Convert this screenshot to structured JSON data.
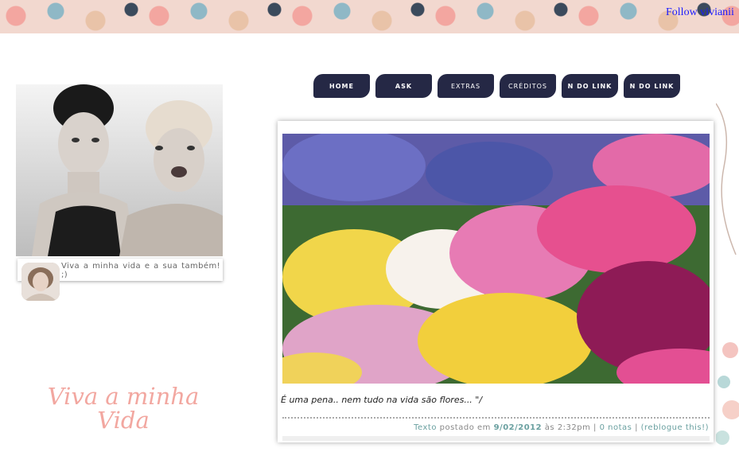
{
  "header": {
    "follow_text": "Follow vivianii"
  },
  "sidebar": {
    "description": "Viva a minha vida e a sua também! ;)",
    "blog_title_line1": "Viva a minha",
    "blog_title_line2": "Vida"
  },
  "nav": {
    "items": [
      "HOME",
      "ASK",
      "EXTRAS",
      "CRÉDITOS",
      "N DO LINK",
      "N DO LINK"
    ]
  },
  "post": {
    "caption": "É uma pena.. nem tudo na vida são flores... \"/",
    "meta": {
      "type": "Texto",
      "posted_on": "postado em",
      "date": "9/02/2012",
      "at": "às",
      "time": "2:32pm",
      "sep1": "|",
      "notes": "0 notas",
      "sep2": "|",
      "reblog": "(reblogue this!)"
    }
  },
  "colors": {
    "nav_bg": "#252845",
    "title_pink": "#f2a7a0",
    "accent_teal": "#6aa0a0"
  }
}
